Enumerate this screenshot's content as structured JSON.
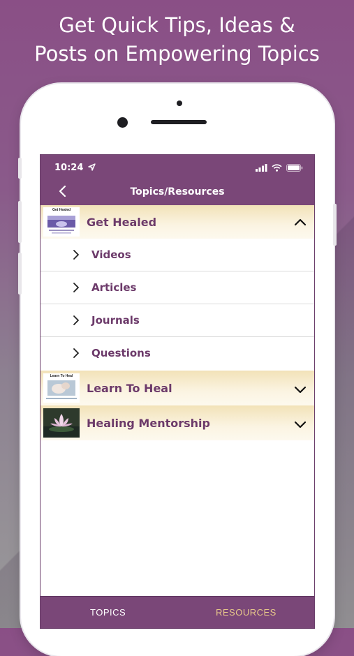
{
  "headline": {
    "line1": "Get Quick Tips, Ideas &",
    "line2": "Posts on Empowering Topics"
  },
  "status_bar": {
    "time": "10:24",
    "icons": [
      "location-arrow-icon",
      "signal-icon",
      "wifi-icon",
      "battery-icon"
    ]
  },
  "nav": {
    "title": "Topics/Resources",
    "back_icon": "chevron-left-icon"
  },
  "topics": [
    {
      "label": "Get Healed",
      "thumbnail_caption": "Get Healed",
      "expanded": true,
      "toggle_icon": "chevron-up-icon",
      "children": [
        "Videos",
        "Articles",
        "Journals",
        "Questions"
      ]
    },
    {
      "label": "Learn To Heal",
      "thumbnail_caption": "Learn To Heal",
      "expanded": false,
      "toggle_icon": "chevron-down-icon"
    },
    {
      "label": "Healing Mentorship",
      "expanded": false,
      "toggle_icon": "chevron-down-icon"
    }
  ],
  "tabs": [
    {
      "label": "TOPICS",
      "active": true,
      "color": "#ffffff"
    },
    {
      "label": "RESOURCES",
      "active": false,
      "color": "#e8c98a"
    }
  ],
  "colors": {
    "brand_purple": "#7a4778",
    "topic_text": "#6c3a6a",
    "topic_bg": "#f2e2b8",
    "tab_inactive": "#e8c98a"
  }
}
